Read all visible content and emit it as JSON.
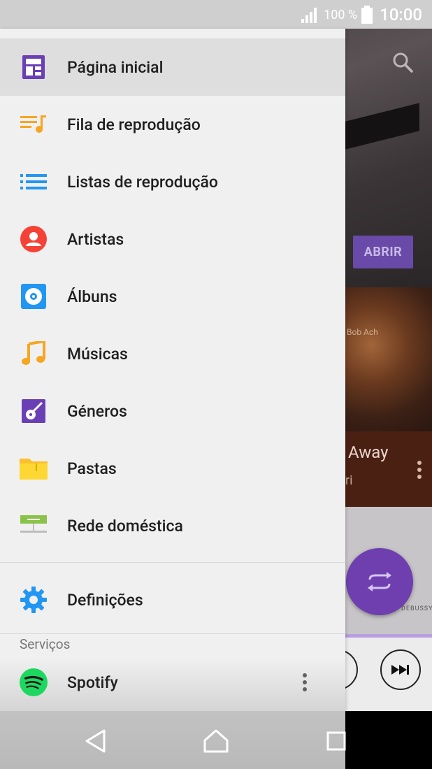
{
  "status_bar": {
    "battery_percent": "100 %",
    "time": "10:00"
  },
  "background_app": {
    "open_button": "ABRIR",
    "song_title": "Away",
    "song_subtitle": "ri",
    "album_caption": "Bob Ach",
    "album_footer": "DEBUSSY",
    "accent_color": "#6f3fb0"
  },
  "drawer": {
    "items": [
      {
        "label": "Página inicial",
        "icon": "home-grid-icon",
        "color": "#6a3fb5",
        "active": true
      },
      {
        "label": "Fila de reprodução",
        "icon": "queue-music-icon",
        "color": "#f5a623"
      },
      {
        "label": "Listas de reprodução",
        "icon": "playlist-icon",
        "color": "#2196f3"
      },
      {
        "label": "Artistas",
        "icon": "artist-icon",
        "color": "#f44336"
      },
      {
        "label": "Álbuns",
        "icon": "album-icon",
        "color": "#2196f3"
      },
      {
        "label": "Músicas",
        "icon": "music-note-icon",
        "color": "#f5a623"
      },
      {
        "label": "Géneros",
        "icon": "guitar-icon",
        "color": "#6a3fb5"
      },
      {
        "label": "Pastas",
        "icon": "folder-icon",
        "color": "#fbc02d"
      },
      {
        "label": "Rede doméstica",
        "icon": "home-network-icon",
        "color": "#8bc34a"
      }
    ],
    "settings_label": "Definições",
    "services_header": "Serviços",
    "spotify_label": "Spotify"
  }
}
